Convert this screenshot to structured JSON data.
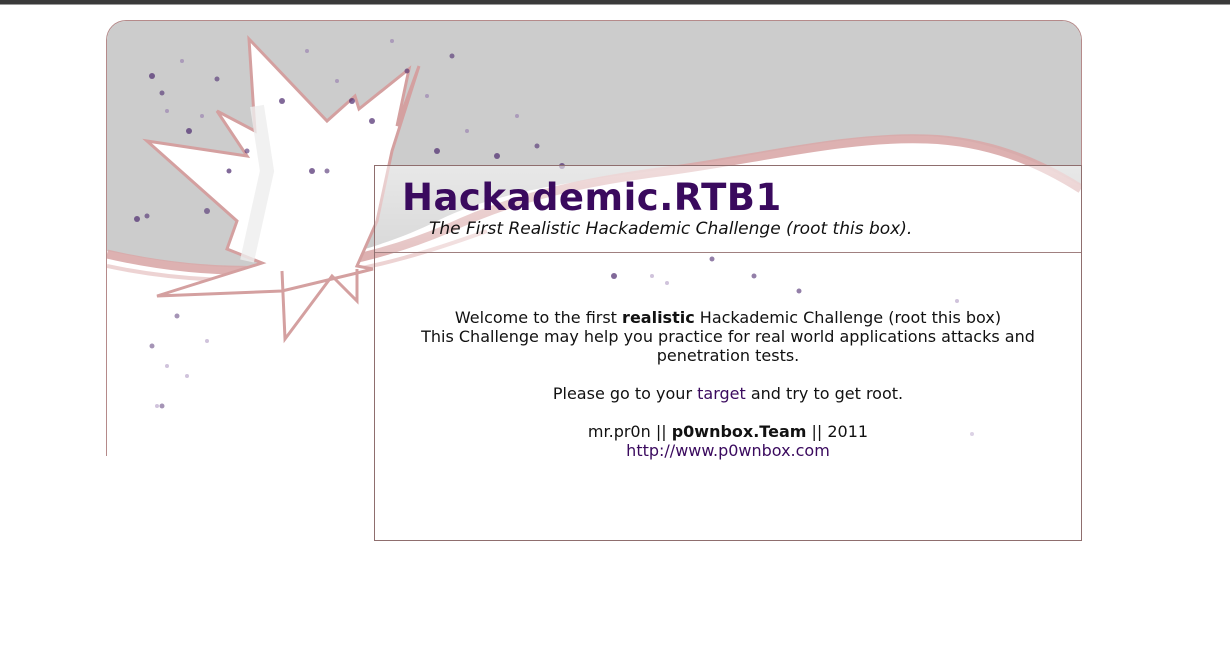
{
  "header": {
    "title": "Hackademic.RTB1",
    "subtitle": "The First Realistic Hackademic Challenge (root this box)."
  },
  "intro": {
    "pre": "Welcome to the first ",
    "bold": "realistic",
    "post": " Hackademic Challenge (root this box)",
    "line2": "This Challenge may help you practice for real world applications attacks and penetration tests."
  },
  "instructions": {
    "pre": "Please go to your ",
    "link": "target",
    "post": " and try to get root."
  },
  "credits": {
    "author": "mr.pr0n || ",
    "team": "p0wnbox.Team",
    "year": " || 2011",
    "url": "http://www.p0wnbox.com"
  },
  "colors": {
    "title": "#3a0a5e",
    "link": "#3a0a5e",
    "frame": "#b58a8a",
    "background_band": "#cccccc",
    "swoosh": "#d9a8a8",
    "dots": "#4b2a6e"
  },
  "decor": {
    "image": "starburst-splash-icon"
  }
}
